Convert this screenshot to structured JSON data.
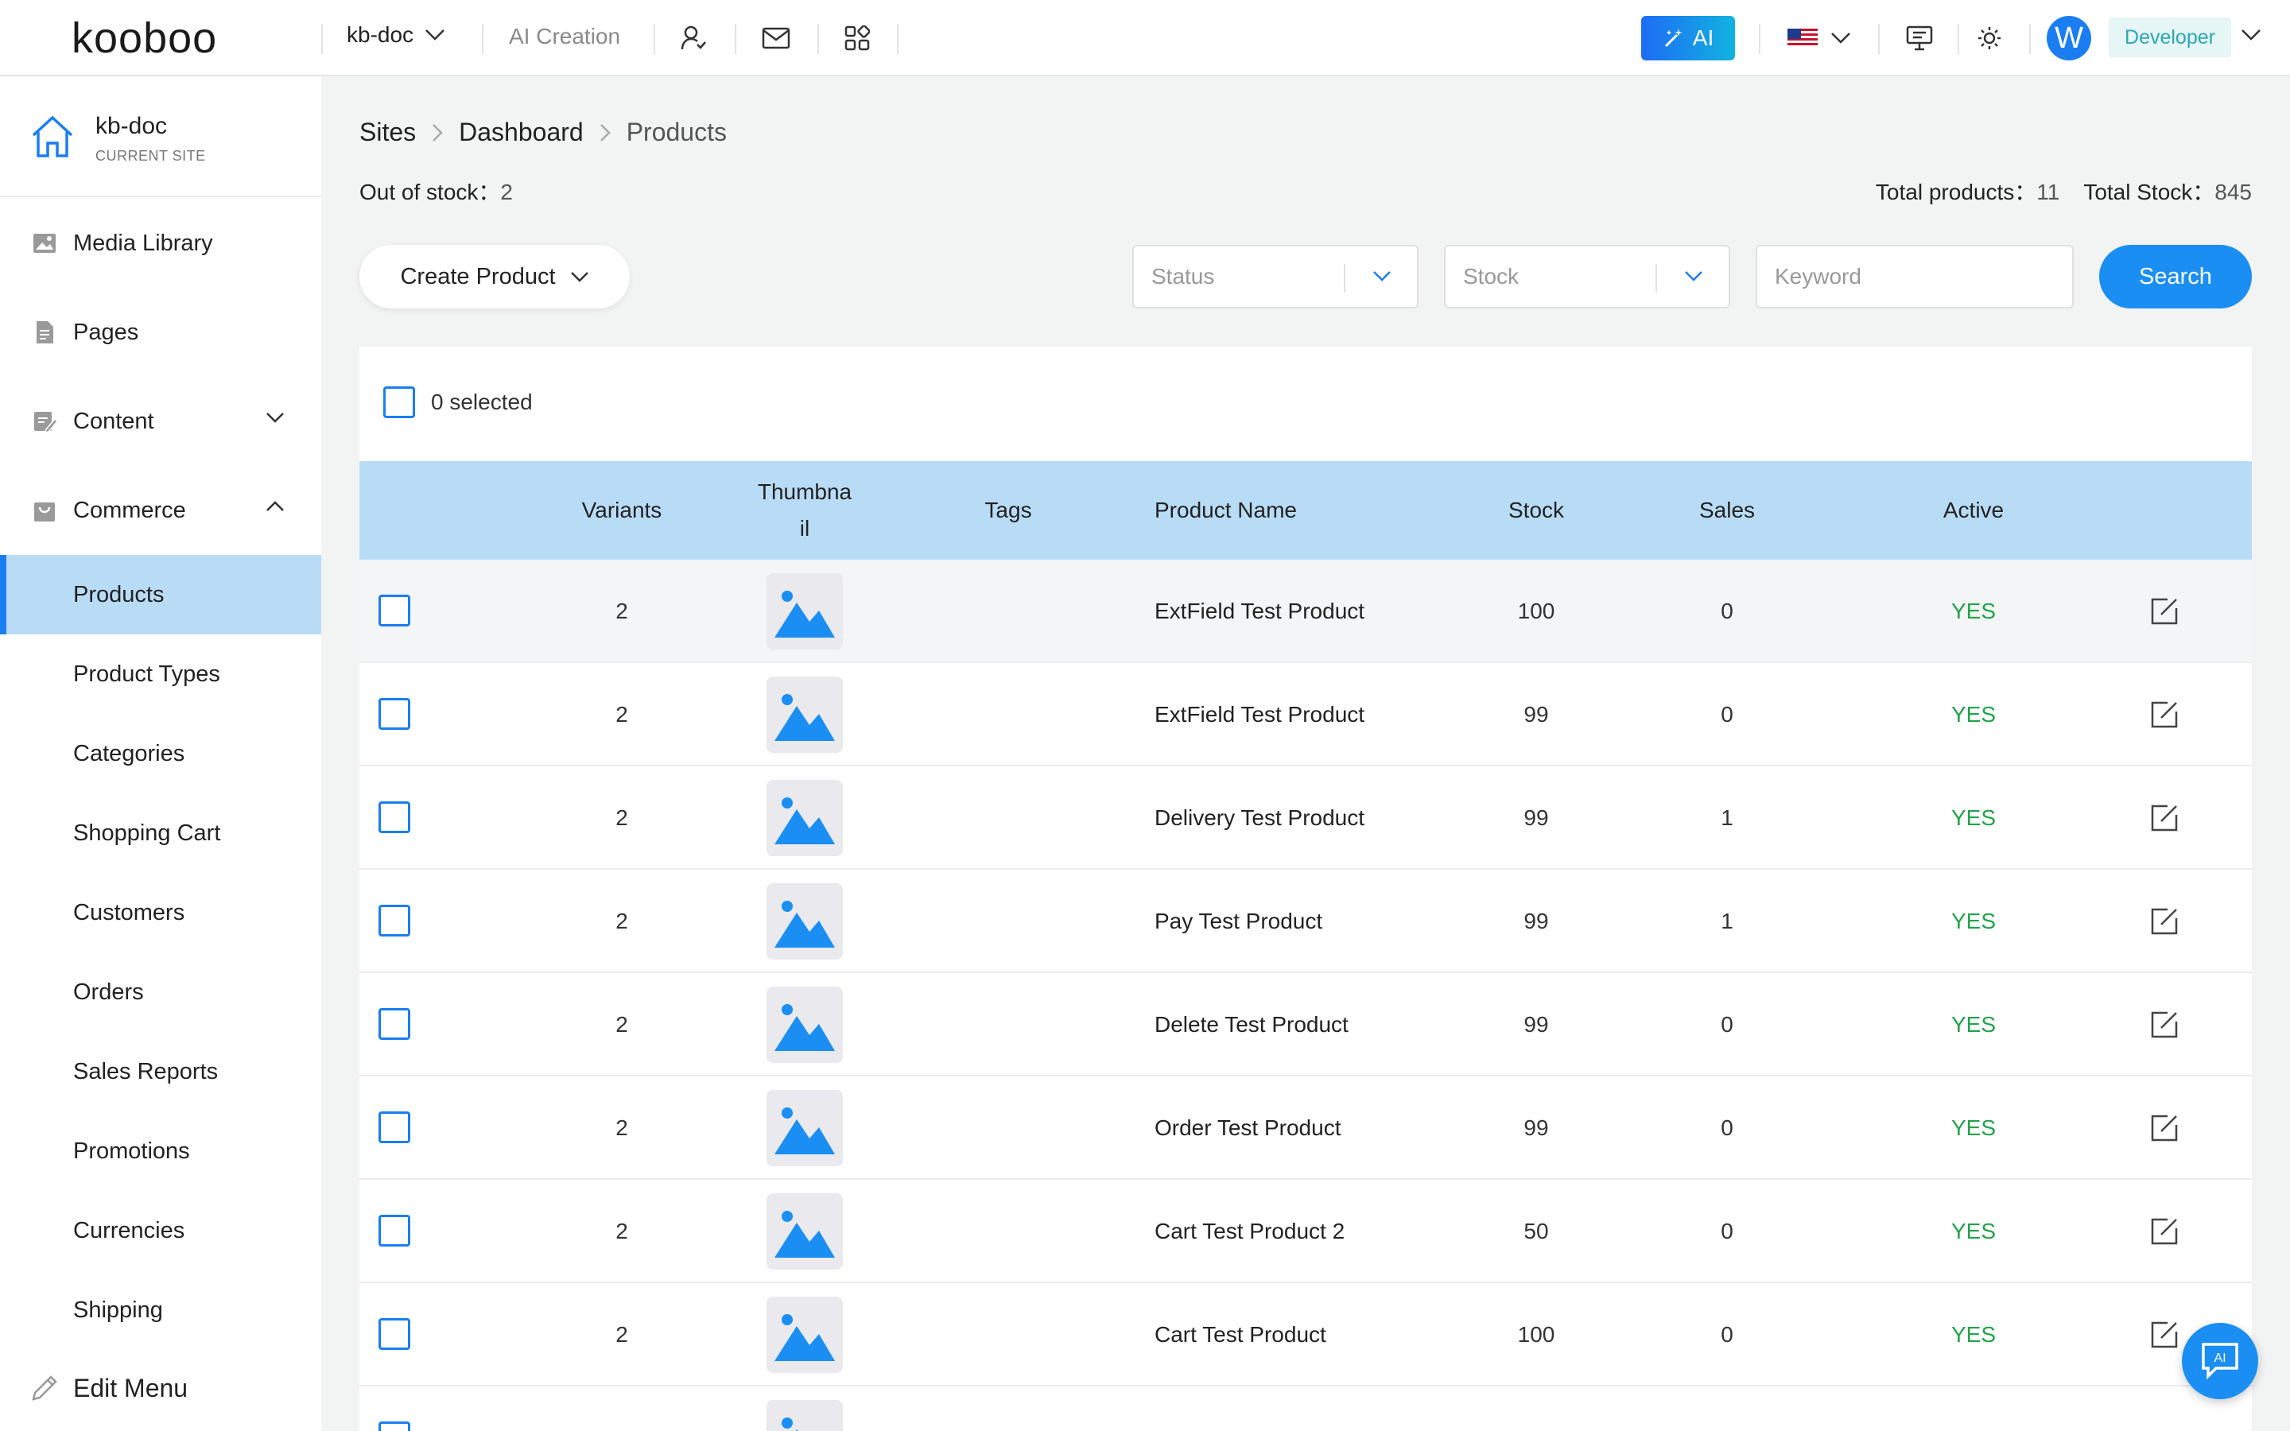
{
  "topbar": {
    "logo": "kooboo",
    "site": "kb-doc",
    "ai_creation": "AI Creation",
    "ai_button": "AI",
    "avatar_letter": "W",
    "role": "Developer"
  },
  "sidebar": {
    "site_name": "kb-doc",
    "site_sub": "CURRENT SITE",
    "items": [
      {
        "label": "Media Library",
        "icon": "image-icon"
      },
      {
        "label": "Pages",
        "icon": "page-icon"
      },
      {
        "label": "Content",
        "icon": "edit-doc-icon"
      },
      {
        "label": "Commerce",
        "icon": "bag-icon"
      }
    ],
    "commerce_items": [
      {
        "label": "Products",
        "active": true
      },
      {
        "label": "Product Types"
      },
      {
        "label": "Categories"
      },
      {
        "label": "Shopping Cart"
      },
      {
        "label": "Customers"
      },
      {
        "label": "Orders"
      },
      {
        "label": "Sales Reports"
      },
      {
        "label": "Promotions"
      },
      {
        "label": "Currencies"
      },
      {
        "label": "Shipping"
      }
    ],
    "edit_menu": "Edit Menu"
  },
  "breadcrumb": [
    "Sites",
    "Dashboard",
    "Products"
  ],
  "stats": {
    "out_of_stock_label": "Out of stock：",
    "out_of_stock_value": "2",
    "total_products_label": "Total products：",
    "total_products_value": "11",
    "total_stock_label": "Total Stock：",
    "total_stock_value": "845"
  },
  "toolbar": {
    "create_product": "Create Product",
    "status_placeholder": "Status",
    "stock_placeholder": "Stock",
    "keyword_placeholder": "Keyword",
    "search": "Search"
  },
  "table": {
    "selected_text": "0 selected",
    "columns": [
      "Variants",
      "Thumbnail",
      "Tags",
      "Product Name",
      "Stock",
      "Sales",
      "Active"
    ],
    "rows": [
      {
        "variants": "2",
        "name": "ExtField Test Product",
        "stock": "100",
        "sales": "0",
        "active": "YES"
      },
      {
        "variants": "2",
        "name": "ExtField Test Product",
        "stock": "99",
        "sales": "0",
        "active": "YES"
      },
      {
        "variants": "2",
        "name": "Delivery Test Product",
        "stock": "99",
        "sales": "1",
        "active": "YES"
      },
      {
        "variants": "2",
        "name": "Pay Test Product",
        "stock": "99",
        "sales": "1",
        "active": "YES"
      },
      {
        "variants": "2",
        "name": "Delete Test Product",
        "stock": "99",
        "sales": "0",
        "active": "YES"
      },
      {
        "variants": "2",
        "name": "Order Test Product",
        "stock": "99",
        "sales": "0",
        "active": "YES"
      },
      {
        "variants": "2",
        "name": "Cart Test Product 2",
        "stock": "50",
        "sales": "0",
        "active": "YES"
      },
      {
        "variants": "2",
        "name": "Cart Test Product",
        "stock": "100",
        "sales": "0",
        "active": "YES"
      }
    ]
  },
  "colors": {
    "accent": "#1a7ef2",
    "header_row": "#b9dcf6",
    "active_green": "#22a34a"
  }
}
